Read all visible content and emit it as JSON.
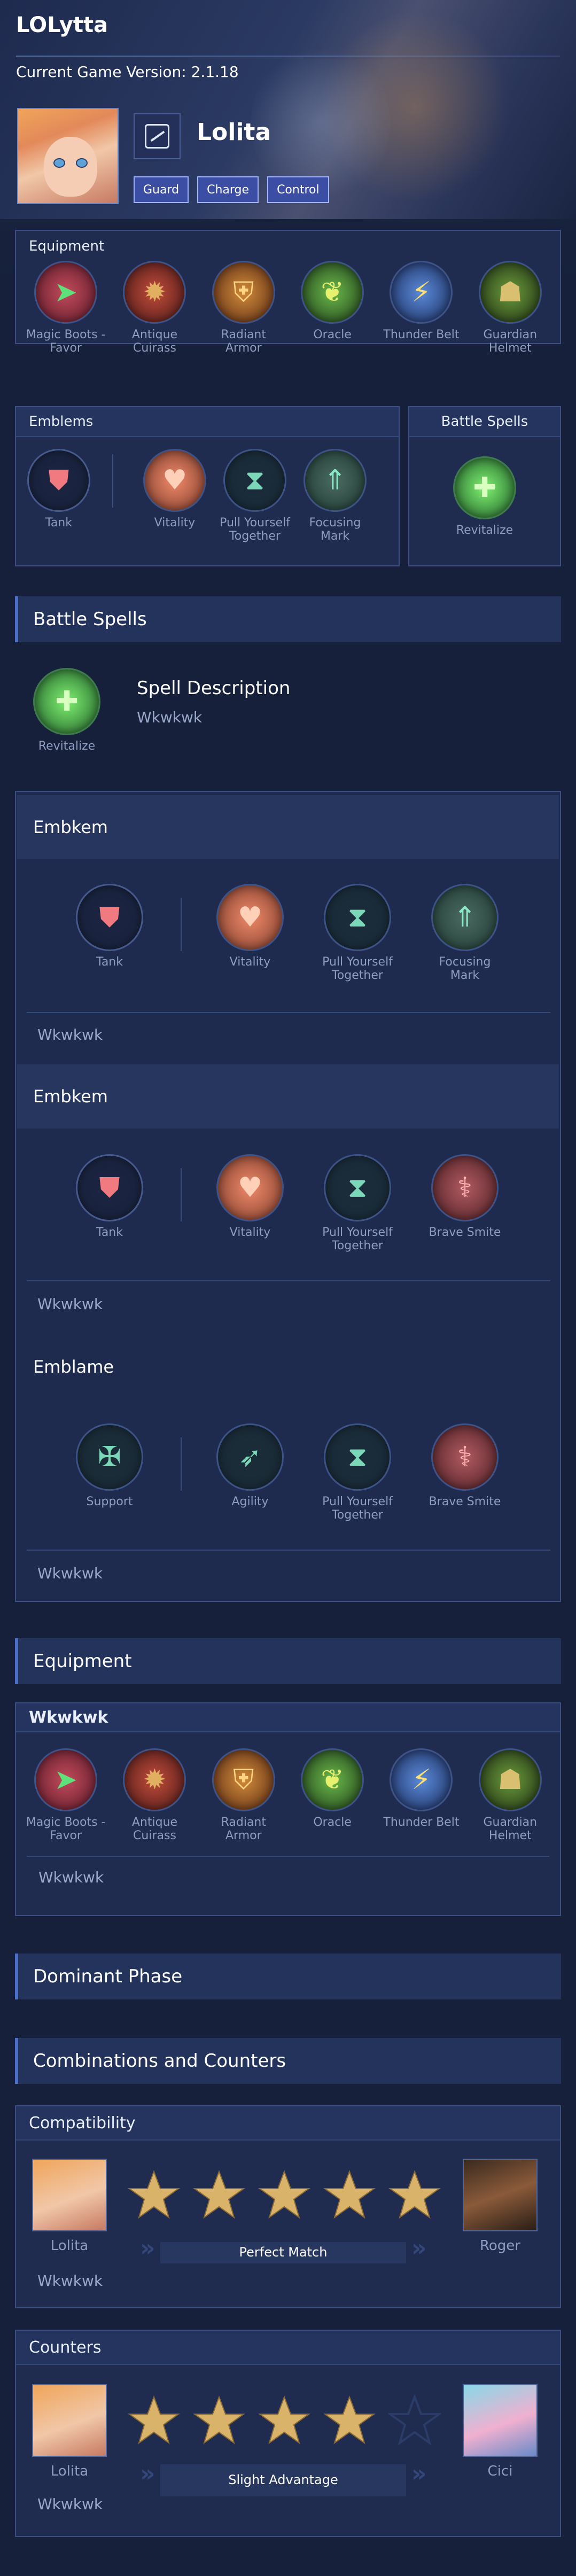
{
  "app_title": "LOLytta",
  "version_text": "Current Game Version: 2.1.18",
  "hero": {
    "name": "Lolita",
    "roles": [
      "Guard",
      "Charge",
      "Control"
    ]
  },
  "equipment_panel": {
    "title": "Equipment",
    "items": [
      {
        "label": "Magic Boots - Favor",
        "icon": "boots-icon",
        "color": "#b8303c"
      },
      {
        "label": "Antique Cuirass",
        "icon": "cuirass-icon",
        "color": "#a8332c"
      },
      {
        "label": "Radiant Armor",
        "icon": "armor-icon",
        "color": "#b5652a"
      },
      {
        "label": "Oracle",
        "icon": "oracle-icon",
        "color": "#4c8c3a"
      },
      {
        "label": "Thunder Belt",
        "icon": "belt-icon",
        "color": "#3a6cb8"
      },
      {
        "label": "Guardian Helmet",
        "icon": "helmet-icon",
        "color": "#4e7a2c"
      }
    ]
  },
  "emblems_panel": {
    "title": "Emblems",
    "items": [
      {
        "label": "Tank",
        "icon": "shield-icon"
      },
      {
        "label": "Vitality",
        "icon": "heart-icon"
      },
      {
        "label": "Pull Yourself Together",
        "icon": "hourglass-icon"
      },
      {
        "label": "Focusing Mark",
        "icon": "arrow-up-icon"
      }
    ]
  },
  "battle_spell_panel": {
    "title": "Battle Spells",
    "spell": "Revitalize"
  },
  "battle_spells_section": {
    "title": "Battle Spells",
    "spell_label": "Revitalize",
    "description_title": "Spell Description",
    "description": "Wkwkwk"
  },
  "emblem_builds": [
    {
      "title": "Embkem",
      "items": [
        "Tank",
        "Vitality",
        "Pull Yourself Together",
        "Focusing Mark"
      ],
      "note": "Wkwkwk"
    },
    {
      "title": "Embkem",
      "items": [
        "Tank",
        "Vitality",
        "Pull Yourself Together",
        "Brave Smite"
      ],
      "note": "Wkwkwk"
    },
    {
      "title": "Emblame",
      "items": [
        "Support",
        "Agility",
        "Pull Yourself Together",
        "Brave Smite"
      ],
      "note": "Wkwkwk"
    }
  ],
  "equipment_section": {
    "title": "Equipment",
    "build_title": "Wkwkwk",
    "items": [
      "Magic Boots - Favor",
      "Antique Cuirass",
      "Radiant Armor",
      "Oracle",
      "Thunder Belt",
      "Guardian Helmet"
    ],
    "note": "Wkwkwk"
  },
  "dominant_phase": {
    "title": "Dominant Phase"
  },
  "combinations": {
    "title": "Combinations and Counters",
    "compatibility": {
      "title": "Compatibility",
      "left_hero": "Lolita",
      "right_hero": "Roger",
      "stars": 5,
      "verdict": "Perfect Match",
      "note": "Wkwkwk"
    },
    "counters": {
      "title": "Counters",
      "left_hero": "Lolita",
      "right_hero": "Cici",
      "stars": 4,
      "verdict": "Slight Advantage",
      "note": "Wkwkwk"
    }
  },
  "colors": {
    "accent": "#4d6fc8",
    "star": "#d9b36a",
    "panel": "#1f2c50"
  }
}
